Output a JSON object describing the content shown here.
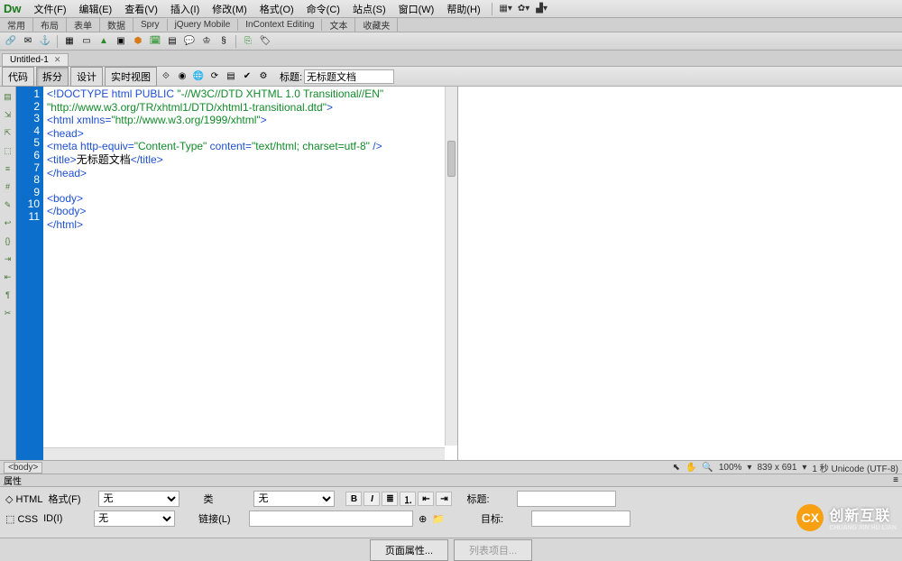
{
  "menu": {
    "items": [
      "文件(F)",
      "编辑(E)",
      "查看(V)",
      "插入(I)",
      "修改(M)",
      "格式(O)",
      "命令(C)",
      "站点(S)",
      "窗口(W)",
      "帮助(H)"
    ]
  },
  "tabstrip": {
    "tabs": [
      "常用",
      "布局",
      "表单",
      "数据",
      "Spry",
      "jQuery Mobile",
      "InContext Editing",
      "文本",
      "收藏夹"
    ]
  },
  "docTab": {
    "name": "Untitled-1"
  },
  "viewbar": {
    "btns": [
      "代码",
      "拆分",
      "设计",
      "实时视图"
    ],
    "titleLabel": "标题:",
    "titleValue": "无标题文档"
  },
  "code": {
    "lines": [
      1,
      2,
      3,
      4,
      5,
      6,
      7,
      8,
      9,
      10,
      11
    ],
    "l1a": "<!DOCTYPE html PUBLIC ",
    "l1b": "\"-//W3C//DTD XHTML 1.0 Transitional//EN\"",
    "l1c": "\"http://www.w3.org/TR/xhtml1/DTD/xhtml1-transitional.dtd\"",
    "l1d": ">",
    "l2a": "<html ",
    "l2b": "xmlns=",
    "l2c": "\"http://www.w3.org/1999/xhtml\"",
    "l2d": ">",
    "l3": "<head>",
    "l4a": "<meta ",
    "l4b": "http-equiv=",
    "l4c": "\"Content-Type\"",
    "l4d": " content=",
    "l4e": "\"text/html; charset=utf-8\"",
    "l4f": " />",
    "l5a": "<title>",
    "l5b": "无标题文档",
    "l5c": "</title>",
    "l6": "</head>",
    "l8": "<body>",
    "l9": "</body>",
    "l10": "</html>"
  },
  "tagbar": {
    "crumb": "<body>",
    "zoom": "100%",
    "size": "839 x 691",
    "status": "1 秒 Unicode (UTF-8)"
  },
  "props": {
    "header": "属性",
    "htmlTab": "HTML",
    "cssTab": "CSS",
    "formatLabel": "格式(F)",
    "formatVal": "无",
    "classLabel": "类",
    "classVal": "无",
    "idLabel": "ID(I)",
    "idVal": "无",
    "linkLabel": "链接(L)",
    "titleLabel": "标题:",
    "targetLabel": "目标:"
  },
  "footer": {
    "pageProps": "页面属性...",
    "listItem": "列表项目..."
  },
  "watermark": {
    "main": "创新互联",
    "sub": "CHUANG XIN HU LIAN"
  }
}
